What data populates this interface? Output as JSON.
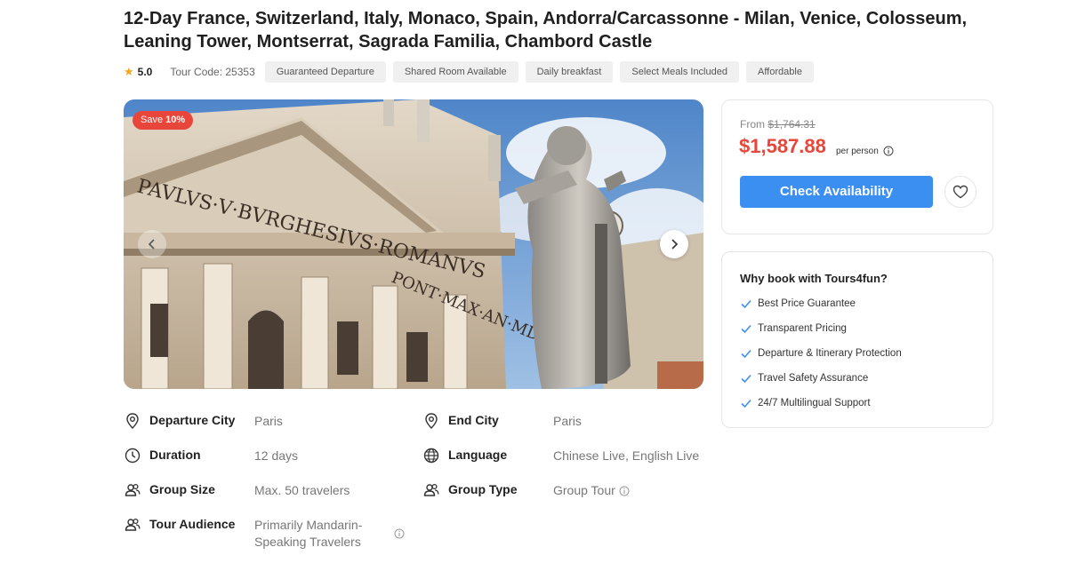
{
  "tour": {
    "title": "12-Day France, Switzerland, Italy, Monaco, Spain, Andorra/Carcassonne - Milan, Venice, Colosseum, Leaning Tower, Montserrat, Sagrada Familia, Chambord Castle",
    "rating": "5.0",
    "tour_code": "Tour Code: 25353",
    "tags": [
      "Guaranteed Departure",
      "Shared Room Available",
      "Daily breakfast",
      "Select Meals Included",
      "Affordable"
    ]
  },
  "gallery": {
    "save_label": "Save",
    "save_percent": "10%",
    "inscription_line1": "PAVLVS·V·BVRGHESIVS·ROMANVS",
    "inscription_line2": "PONT·MAX·AN·MDCXII"
  },
  "details": {
    "departure_city": {
      "label": "Departure City",
      "value": "Paris"
    },
    "end_city": {
      "label": "End City",
      "value": "Paris"
    },
    "duration": {
      "label": "Duration",
      "value": "12 days"
    },
    "language": {
      "label": "Language",
      "value": "Chinese Live, English Live"
    },
    "group_size": {
      "label": "Group Size",
      "value": "Max. 50 travelers"
    },
    "group_type": {
      "label": "Group Type",
      "value": "Group Tour"
    },
    "tour_audience": {
      "label": "Tour Audience",
      "value_line1": "Primarily Mandarin-",
      "value_line2": "Speaking Travelers"
    }
  },
  "pricing": {
    "from_label": "From",
    "original_price": "$1,764.31",
    "price": "$1,587.88",
    "per_person": "per person",
    "check_button": "Check Availability"
  },
  "why_book": {
    "title": "Why book with Tours4fun?",
    "items": [
      "Best Price Guarantee",
      "Transparent Pricing",
      "Departure & Itinerary Protection",
      "Travel Safety Assurance",
      "24/7 Multilingual Support"
    ]
  },
  "colors": {
    "accent_blue": "#3b8ff0",
    "price_red": "#e8463b",
    "star_gold": "#f5a623"
  },
  "icons": [
    "star-icon",
    "chevron-left-icon",
    "chevron-right-icon",
    "location-pin-icon",
    "clock-icon",
    "globe-icon",
    "users-icon",
    "info-icon",
    "heart-icon",
    "check-icon"
  ]
}
